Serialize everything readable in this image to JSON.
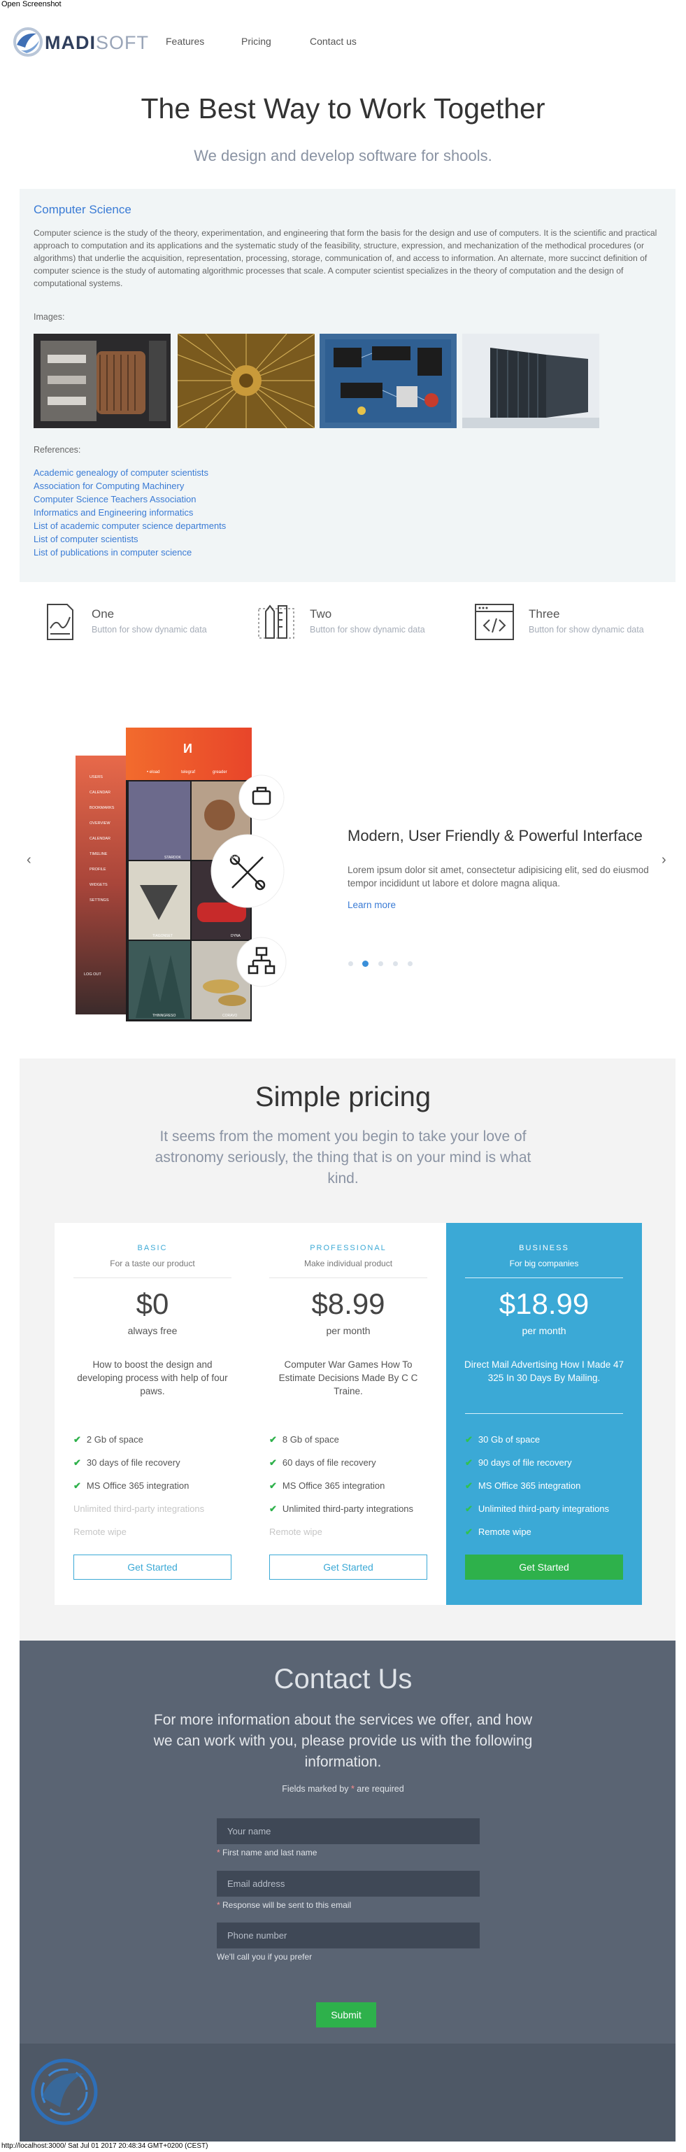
{
  "print": {
    "header": "Open Screenshot",
    "footer": "http://localhost:3000/ Sat Jul 01 2017 20:48:34 GMT+0200 (CEST)"
  },
  "brand": {
    "name_bold": "MADI",
    "name_light": "SOFT"
  },
  "nav": {
    "items": [
      "Features",
      "Pricing",
      "Contact us"
    ]
  },
  "hero": {
    "title": "The Best Way to Work Together",
    "subtitle": "We design and develop software for shools."
  },
  "cs": {
    "title": "Computer Science",
    "description": "Computer science is the study of the theory, experimentation, and engineering that form the basis for the design and use of computers. It is the scientific and practical approach to computation and its applications and the systematic study of the feasibility, structure, expression, and mechanization of the methodical procedures (or algorithms) that underlie the acquisition, representation, processing, storage, communication of, and access to information. An alternate, more succinct definition of computer science is the study of automating algorithmic processes that scale. A computer scientist specializes in the theory of computation and the design of computational systems.",
    "images_label": "Images:",
    "references_label": "References:",
    "references": [
      "Academic genealogy of computer scientists",
      "Association for Computing Machinery",
      "Computer Science Teachers Association",
      "Informatics and Engineering informatics",
      "List of academic computer science departments",
      "List of computer scientists",
      "List of publications in computer science"
    ]
  },
  "features": [
    {
      "title": "One",
      "subtitle": "Button for show dynamic data",
      "icon": "chart-document-icon"
    },
    {
      "title": "Two",
      "subtitle": "Button for show dynamic data",
      "icon": "pencil-ruler-icon"
    },
    {
      "title": "Three",
      "subtitle": "Button for show dynamic data",
      "icon": "code-window-icon"
    }
  ],
  "slider": {
    "title": "Modern, User Friendly & Powerful Interface",
    "text": "Lorem ipsum dolor sit amet, consectetur adipisicing elit, sed do eiusmod tempor incididunt ut labore et dolore magna aliqua.",
    "link": "Learn more",
    "prev": "‹",
    "next": "›",
    "active_slide": 2,
    "slide_count": 5,
    "phone": {
      "logo": "И",
      "tabs": [
        "• eload",
        "telegraf",
        "greader"
      ],
      "menu": [
        "USERS",
        "CALENDAR",
        "BOOKMARKS",
        "OVERVIEW",
        "CALENDAR",
        "TIMELINE",
        "PROFILE",
        "WIDGETS",
        "SETTINGS"
      ],
      "logout": "LOG OUT",
      "tiles": [
        "STARDOK",
        "BONSAR",
        "TIAGONSET",
        "DYNA",
        "THINNGRESO",
        "CORAVO"
      ]
    }
  },
  "pricing": {
    "title": "Simple pricing",
    "subtitle": "It seems from the moment you begin to take your love of astronomy seriously, the thing that is on your mind is what kind.",
    "plans": [
      {
        "name": "BASIC",
        "tagline": "For a taste our product",
        "price": "$0",
        "period": "always free",
        "description": "How to boost the design and developing process with help of four paws.",
        "features": [
          {
            "text": "2 Gb of space",
            "included": true
          },
          {
            "text": "30 days of file recovery",
            "included": true
          },
          {
            "text": "MS Office 365 integration",
            "included": true
          },
          {
            "text": "Unlimited third-party integrations",
            "included": false
          },
          {
            "text": "Remote wipe",
            "included": false
          }
        ],
        "button": "Get Started"
      },
      {
        "name": "PROFESSIONAL",
        "tagline": "Make individual product",
        "price": "$8.99",
        "period": "per month",
        "description": "Computer War Games How To Estimate Decisions Made By C C Traine.",
        "features": [
          {
            "text": "8 Gb of space",
            "included": true
          },
          {
            "text": "60 days of file recovery",
            "included": true
          },
          {
            "text": "MS Office 365 integration",
            "included": true
          },
          {
            "text": "Unlimited third-party integrations",
            "included": true
          },
          {
            "text": "Remote wipe",
            "included": false
          }
        ],
        "button": "Get Started"
      },
      {
        "name": "BUSINESS",
        "tagline": "For big companies",
        "price": "$18.99",
        "period": "per month",
        "description": "Direct Mail Advertising How I Made 47 325 In 30 Days By Mailing.",
        "features": [
          {
            "text": "30 Gb of space",
            "included": true
          },
          {
            "text": "90 days of file recovery",
            "included": true
          },
          {
            "text": "MS Office 365 integration",
            "included": true
          },
          {
            "text": "Unlimited third-party integrations",
            "included": true
          },
          {
            "text": "Remote wipe",
            "included": true
          }
        ],
        "button": "Get Started"
      }
    ]
  },
  "contact": {
    "title": "Contact Us",
    "subtitle": "For more information about the services we offer, and how we can work with you, please provide us with the following information.",
    "required_note_a": "Fields marked by ",
    "required_note_star": "*",
    "required_note_b": " are required",
    "name_placeholder": "Your name",
    "name_hint": "First name and last name",
    "email_placeholder": "Email address",
    "email_hint": "Response will be sent to this email",
    "phone_placeholder": "Phone number",
    "phone_hint": "We'll call you if you prefer",
    "submit": "Submit"
  },
  "colors": {
    "accent": "#3a7bd5",
    "pricing_featured": "#3ba9d6",
    "success": "#2eb14b",
    "contact_bg": "#5a6473"
  }
}
